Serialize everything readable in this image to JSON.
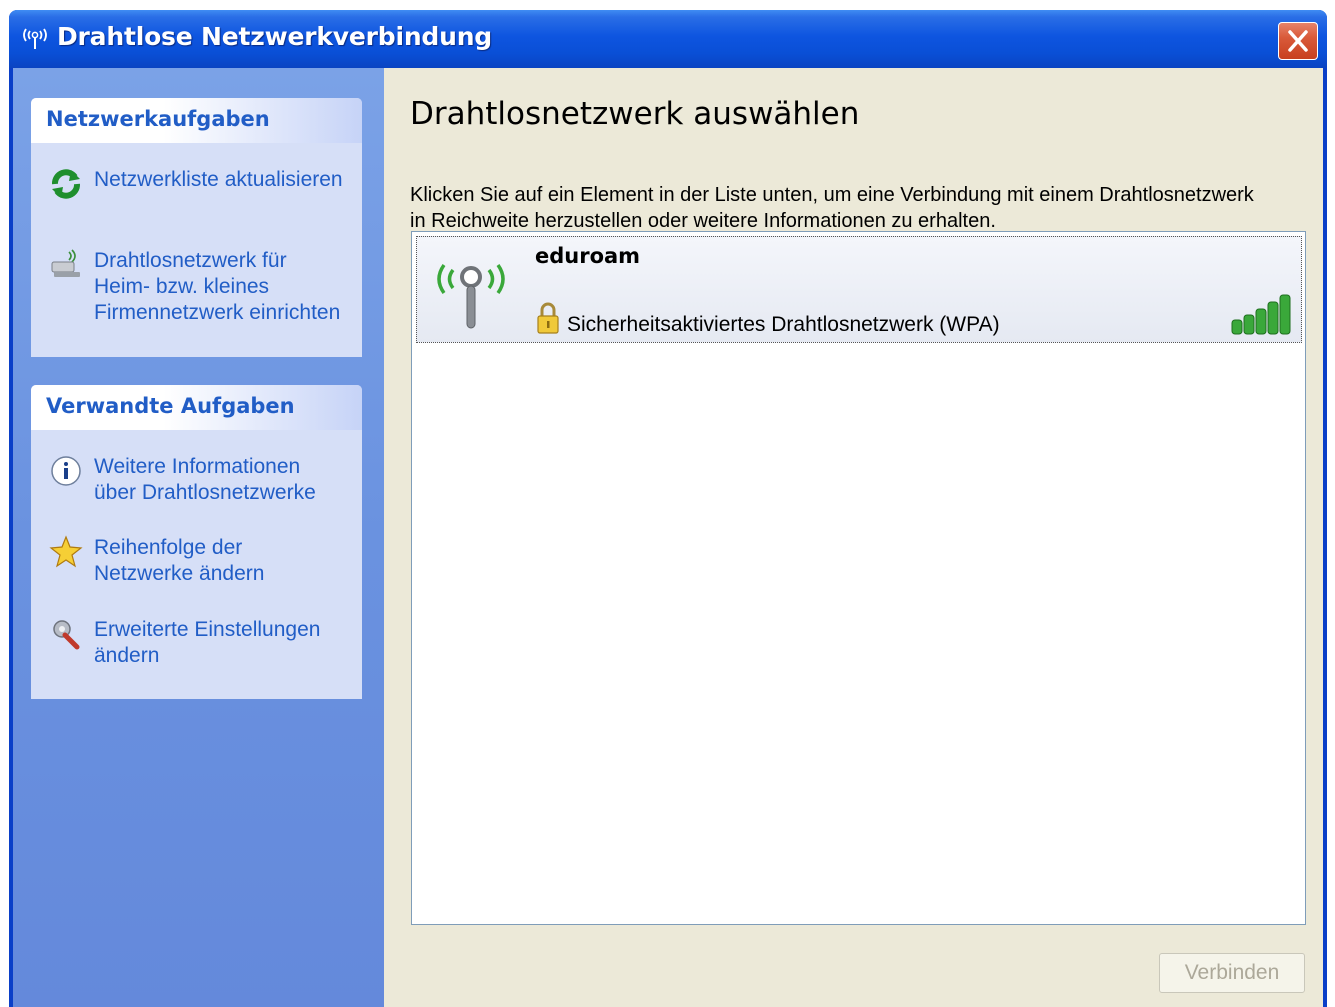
{
  "window": {
    "title": "Drahtlose Netzwerkverbindung"
  },
  "sidebar": {
    "network_tasks": {
      "title": "Netzwerkaufgaben",
      "items": [
        {
          "label": "Netzwerkliste aktualisieren",
          "icon": "refresh-icon"
        },
        {
          "label": "Drahtlosnetzwerk für\nHeim- bzw. kleines\nFirmennetzwerk einrichten",
          "icon": "wireless-setup-icon"
        }
      ]
    },
    "related_tasks": {
      "title": "Verwandte Aufgaben",
      "items": [
        {
          "label": "Weitere Informationen\nüber Drahtlosnetzwerke",
          "icon": "info-icon"
        },
        {
          "label": "Reihenfolge der\nNetzwerke ändern",
          "icon": "star-icon"
        },
        {
          "label": "Erweiterte Einstellungen\nändern",
          "icon": "settings-tools-icon"
        }
      ]
    }
  },
  "main": {
    "title": "Drahtlosnetzwerk auswählen",
    "instructions": "Klicken Sie auf ein Element in der Liste unten, um eine Verbindung mit einem Drahtlosnetzwerk in Reichweite herzustellen oder weitere Informationen zu erhalten.",
    "networks": [
      {
        "name": "eduroam",
        "security": "Sicherheitsaktiviertes Drahtlosnetzwerk (WPA)",
        "signal_bars": 5,
        "signal_max": 5
      }
    ],
    "connect_label": "Verbinden"
  },
  "colors": {
    "title_bar": "#0a4fd6",
    "sidebar": "#6a92e0",
    "task_link": "#215dc6",
    "signal_green": "#3aa83a"
  }
}
